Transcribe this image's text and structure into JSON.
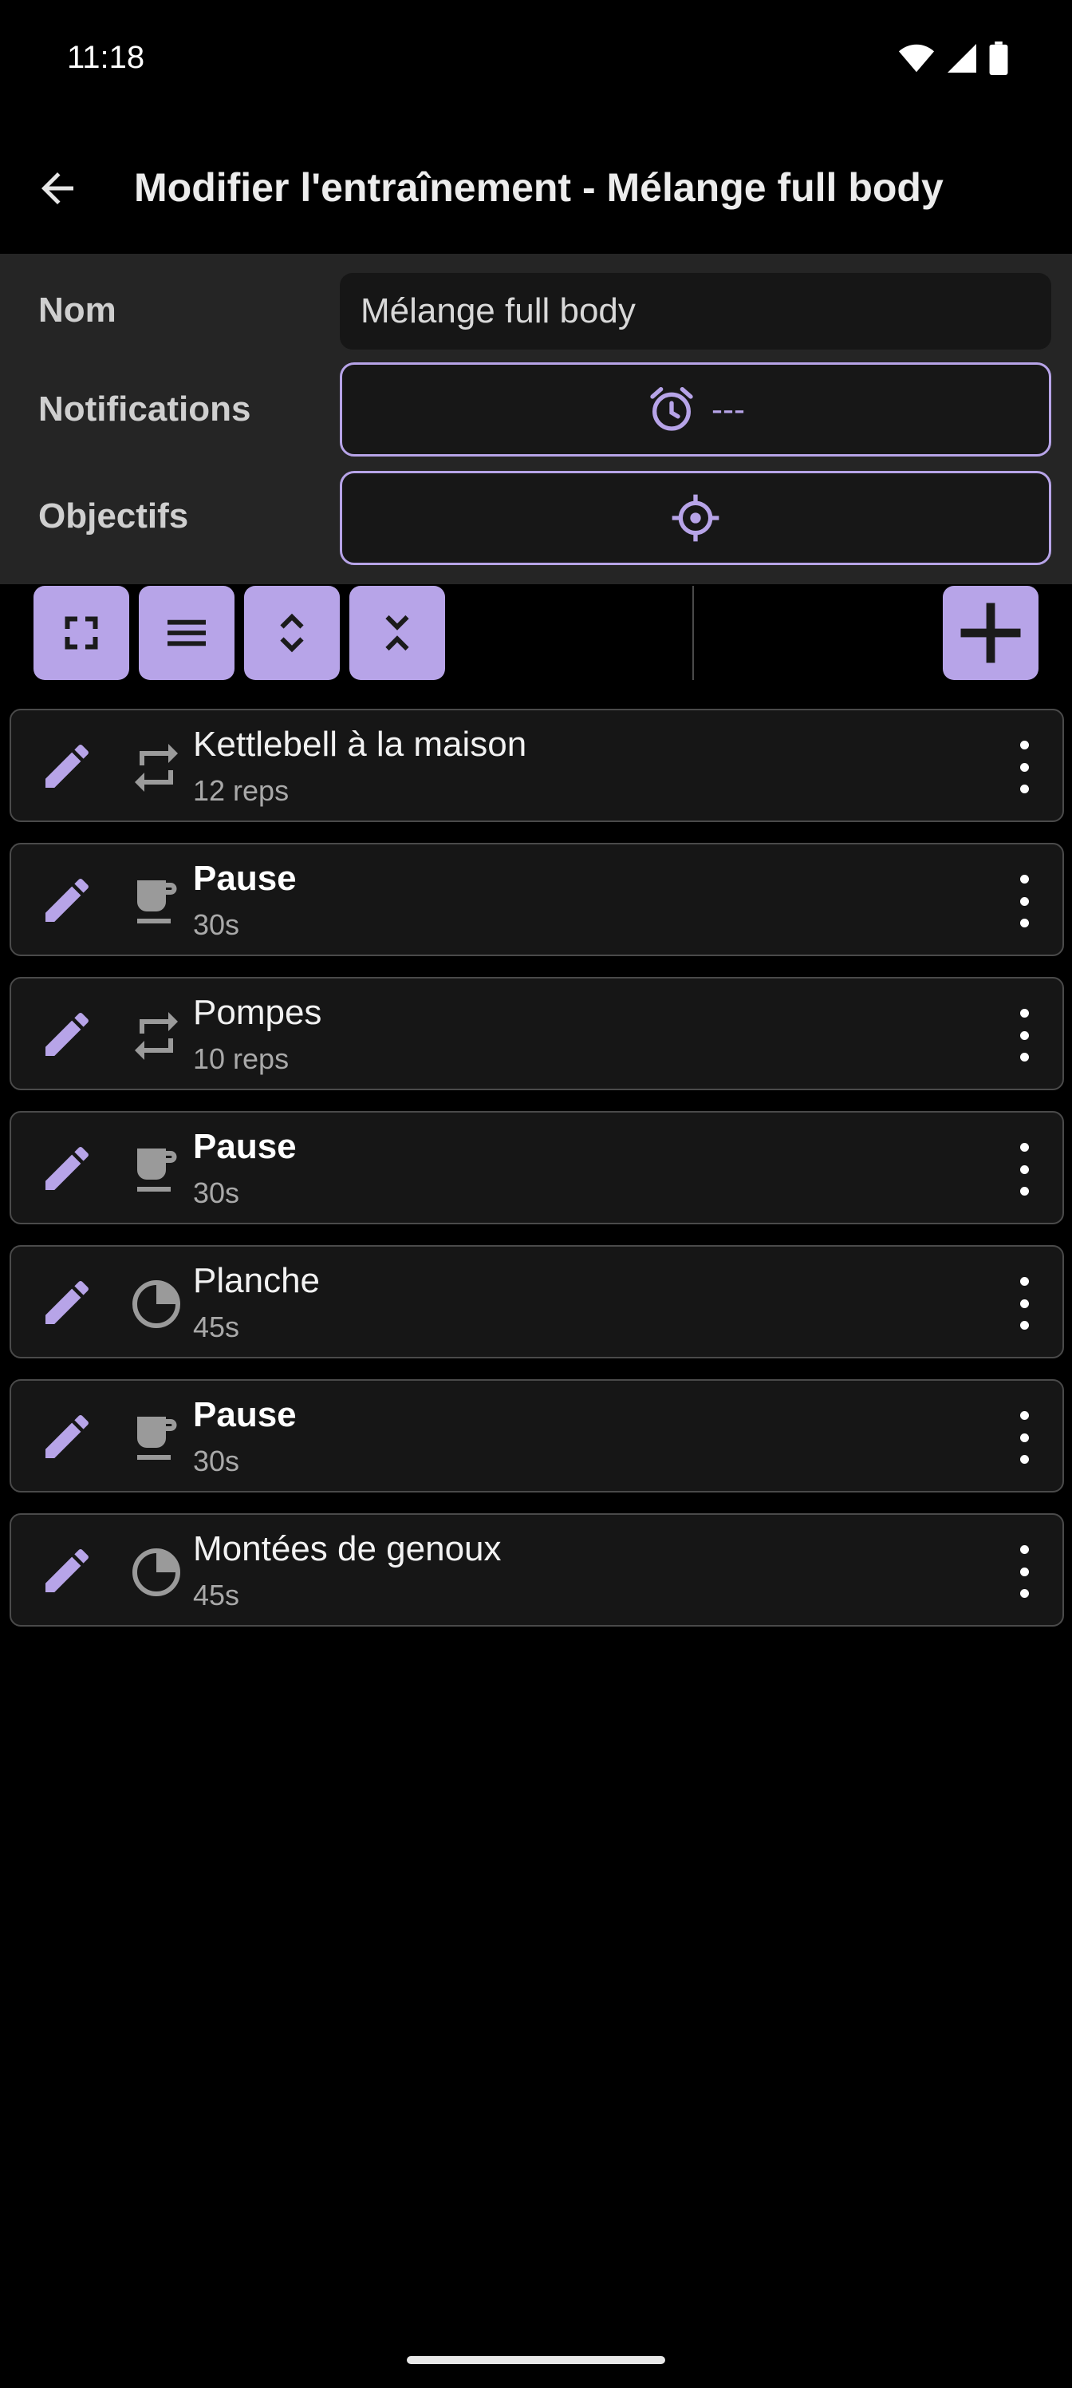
{
  "status_bar": {
    "time": "11:18"
  },
  "app_bar": {
    "title": "Modifier l'entraînement - Mélange full body"
  },
  "form": {
    "name_label": "Nom",
    "name_value": "Mélange full body",
    "notifications_label": "Notifications",
    "notifications_value": "---",
    "goals_label": "Objectifs"
  },
  "toolbar": {
    "buttons": [
      "expand-all",
      "list-view",
      "unfold",
      "fold"
    ],
    "add_button": "add"
  },
  "exercises": [
    {
      "title": "Kettlebell à la maison",
      "detail": "12 reps",
      "type": "repeat-icon",
      "bold": false
    },
    {
      "title": "Pause",
      "detail": "30s",
      "type": "coffee-cup-icon",
      "bold": true
    },
    {
      "title": "Pompes",
      "detail": "10 reps",
      "type": "repeat-icon",
      "bold": false
    },
    {
      "title": "Pause",
      "detail": "30s",
      "type": "coffee-cup-icon",
      "bold": true
    },
    {
      "title": "Planche",
      "detail": "45s",
      "type": "timer-icon",
      "bold": false
    },
    {
      "title": "Pause",
      "detail": "30s",
      "type": "coffee-cup-icon",
      "bold": true
    },
    {
      "title": "Montées de genoux",
      "detail": "45s",
      "type": "timer-icon",
      "bold": false
    }
  ],
  "colors": {
    "accent": "#b7a4e8",
    "background": "#000000",
    "panel": "#252525"
  }
}
